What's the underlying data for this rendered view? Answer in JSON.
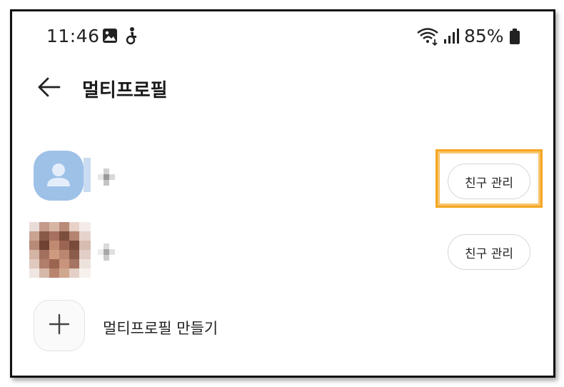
{
  "status_bar": {
    "time": "11:46",
    "battery": "85%",
    "icons": [
      "gallery-icon",
      "accessibility-icon",
      "wifi-icon",
      "signal-icon",
      "battery-icon"
    ]
  },
  "header": {
    "back_icon": "arrow-left-icon",
    "title": "멀티프로필"
  },
  "profiles": [
    {
      "avatar": "default-person-avatar",
      "manage_label": "친구 관리",
      "highlighted": true
    },
    {
      "avatar": "photo-avatar-pixelated",
      "manage_label": "친구 관리",
      "highlighted": false
    }
  ],
  "create": {
    "icon": "plus-icon",
    "label": "멀티프로필 만들기"
  },
  "colors": {
    "highlight": "#f5a623",
    "default_avatar": "#9ec1e8"
  }
}
